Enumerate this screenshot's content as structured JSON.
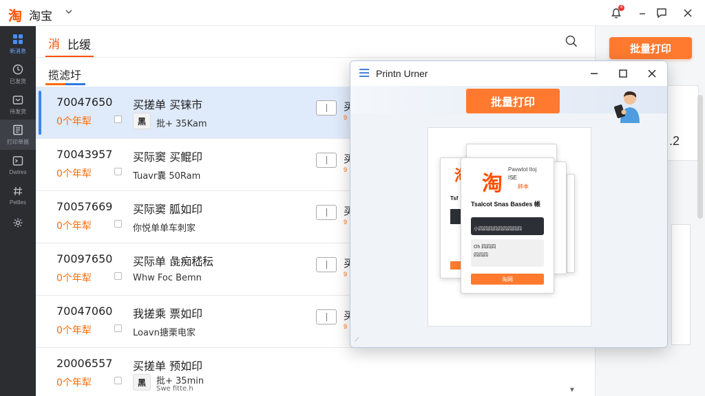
{
  "titlebar": {
    "logo": "淘",
    "title": "淘宝",
    "notification_count": "4"
  },
  "sidebar": {
    "items": [
      {
        "label": "新消息",
        "icon": "grid-icon"
      },
      {
        "label": "已发货",
        "icon": "clock-icon"
      },
      {
        "label": "待发货",
        "icon": "box-icon"
      },
      {
        "label": "打印单据",
        "icon": "printer-doc-icon"
      },
      {
        "label": "Dwtres",
        "icon": "terminal-icon"
      },
      {
        "label": "Petlles",
        "icon": "hash-icon"
      },
      {
        "label": "",
        "icon": "gear-icon"
      }
    ]
  },
  "main": {
    "tab_icon": "消",
    "tab_label": "比缓",
    "subtab_label": "揽滤圩"
  },
  "orders": [
    {
      "id": "70047650",
      "qty": "0个年犁",
      "title": "买搓单 买铼市",
      "thumb": "黑",
      "sub": "批+ 35Kam",
      "peek": "买",
      "peek2": "9"
    },
    {
      "id": "70043957",
      "qty": "0个年犁",
      "title": "买际窦 买鲲印",
      "thumb": "",
      "sub": "Tuavr囊 50Ram",
      "peek": "买",
      "peek2": "9"
    },
    {
      "id": "70057669",
      "qty": "0个年犁",
      "title": "买际窦 胍如印",
      "thumb": "",
      "sub": "你悦单单车刺家",
      "peek": "买",
      "peek2": "9"
    },
    {
      "id": "70097650",
      "qty": "0个年犁",
      "title": "买际单 彘痴嵇秐",
      "thumb": "",
      "sub": "Whw Foc Bemn",
      "peek": "买",
      "peek2": "9"
    },
    {
      "id": "70047060",
      "qty": "0个年犁",
      "title": "我搓乘 票如印",
      "thumb": "",
      "sub": "Loavn搪栗电家",
      "peek": "买",
      "peek2": "9"
    },
    {
      "id": "20006557",
      "qty": "0个年犁",
      "title": "买搓单 预如印",
      "thumb": "黑",
      "sub": "批+ 35min",
      "sub2": "Swe fitte.h",
      "peek": "",
      "peek2": ""
    }
  ],
  "right_panel": {
    "batch_print_label": "批量打印",
    "value": ".2"
  },
  "dialog": {
    "title": "Printn Urner",
    "batch_print_label": "批量打印",
    "preview": {
      "logo": "淘",
      "top_line1": "Pavwtot Itoj",
      "top_line2": "ISE",
      "top_line3": "帥本",
      "heading": "Tsalcot Snas Basdes 帳",
      "dark_text": "小四四四四四四四四四",
      "light_text1": "Oh 四四四",
      "light_text2": "四四四",
      "button_label": "淘网",
      "back_logo": "淘",
      "back_text": "Tsf"
    }
  },
  "colors": {
    "accent_orange": "#ff7a2f",
    "brand_orange": "#ff5000",
    "selected_row": "#dfeafa",
    "selected_bar": "#3a86e8",
    "sidebar_bg": "#2b2d31"
  }
}
